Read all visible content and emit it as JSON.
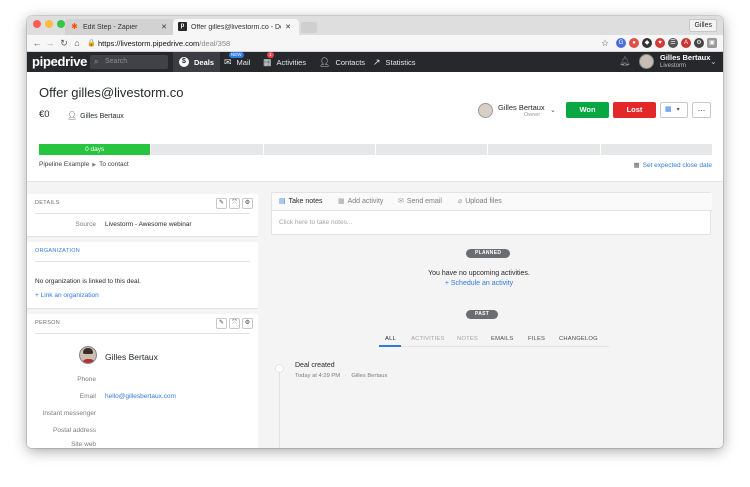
{
  "browser": {
    "tabs": [
      {
        "title": "Edit Step - Zapier",
        "icon": "zapier-icon"
      },
      {
        "title": "Offer gilles@livestorm.co - De",
        "icon": "pipedrive-icon"
      }
    ],
    "profile": "Gilles",
    "url_host": "https://livestorm.pipedrive.com",
    "url_path": "/deal/358"
  },
  "nav": {
    "logo": "pipedrive",
    "search_placeholder": "Search",
    "items": [
      {
        "label": "Deals",
        "icon": "dollar-icon"
      },
      {
        "label": "Mail",
        "icon": "mail-icon",
        "badge": "NEW"
      },
      {
        "label": "Activities",
        "icon": "calendar-icon",
        "badge": "1"
      },
      {
        "label": "Contacts",
        "icon": "person-icon"
      },
      {
        "label": "Statistics",
        "icon": "trend-icon"
      }
    ],
    "user_name": "Gilles Bertaux",
    "user_company": "Livestorm"
  },
  "deal": {
    "title": "Offer gilles@livestorm.co",
    "value": "€0",
    "person": "Gilles Bertaux",
    "owner_name": "Gilles Bertaux",
    "owner_role": "Owner",
    "won_label": "Won",
    "lost_label": "Lost",
    "stage_label": "0 days",
    "stage_count": 6,
    "pipeline": "Pipeline Example",
    "stage_name": "To contact",
    "close_date_link": "Set expected close date"
  },
  "details": {
    "title": "DETAILS",
    "fields": [
      {
        "label": "Source",
        "value": "Livestorm - Awesome webinar"
      }
    ]
  },
  "organization": {
    "title": "ORGANIZATION",
    "empty_text": "No organization is linked to this deal.",
    "link_text": "+ Link an organization"
  },
  "person": {
    "title": "PERSON",
    "name": "Gilles Bertaux",
    "fields": [
      {
        "label": "Phone",
        "value": ""
      },
      {
        "label": "Email",
        "value": "hello@gillesbertaux.com"
      },
      {
        "label": "Instant messenger",
        "value": ""
      },
      {
        "label": "Postal address",
        "value": ""
      },
      {
        "label": "Site web",
        "value": ""
      }
    ]
  },
  "notes": {
    "tabs": [
      {
        "label": "Take notes",
        "icon": "note-icon"
      },
      {
        "label": "Add activity",
        "icon": "calendar-icon"
      },
      {
        "label": "Send email",
        "icon": "envelope-icon"
      },
      {
        "label": "Upload files",
        "icon": "paperclip-icon"
      }
    ],
    "placeholder": "Click here to take notes..."
  },
  "timeline": {
    "planned_label": "PLANNED",
    "no_activities": "You have no upcoming activities.",
    "schedule_link": "+ Schedule an activity",
    "past_label": "PAST",
    "filters": [
      "ALL",
      "ACTIVITIES",
      "NOTES",
      "EMAILS",
      "FILES",
      "CHANGELOG"
    ],
    "event_title": "Deal created",
    "event_time": "Today at 4:29 PM",
    "event_user": "Gilles Bertaux"
  },
  "colors": {
    "won": "#08a742",
    "lost": "#e22828",
    "accent": "#317ae2",
    "nav_bg": "#26292c",
    "stage_done": "#27c440"
  }
}
